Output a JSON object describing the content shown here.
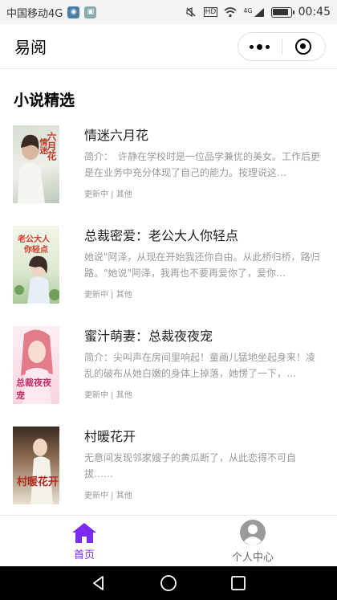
{
  "status_bar": {
    "carrier": "中国移动4G",
    "time": "00:45",
    "network": "4G",
    "hd": "HD",
    "battery_level": 0.9
  },
  "navbar": {
    "title": "易阅"
  },
  "section": {
    "title": "小说精选"
  },
  "books": [
    {
      "title": "情迷六月花",
      "desc": "简介：　许静在学校时是一位品学兼优的美女。工作后更是在业务中充分体现了自己的能力。按理说这…",
      "meta": "更新中 | 其他",
      "cover_text": "六月花 情迷",
      "cover_colors": [
        "#cfd8d0",
        "#f2f2ec"
      ]
    },
    {
      "title": "总裁密爱：老公大人你轻点",
      "desc": "她说\"阿泽，从现在开始我还你自由。从此桥归桥，路归路。\"她说\"阿泽，我再也不要再爱你了，爱你…",
      "meta": "更新中 | 其他",
      "cover_text": "老公大人 你轻点",
      "cover_colors": [
        "#e8f0dc",
        "#c9dcc0"
      ]
    },
    {
      "title": "蜜汁萌妻：总裁夜夜宠",
      "desc": "简介：尖叫声在房间里响起！童画儿猛地坐起身来！凌乱的破布从她白嫩的身体上掉落，她愣了一下，…",
      "meta": "更新中 | 其他",
      "cover_text": "总裁夜夜宠",
      "cover_colors": [
        "#f7d9e3",
        "#fbeef2"
      ]
    },
    {
      "title": "村暖花开",
      "desc": "无意间发现邻家嫂子的黄瓜断了，从此恋得不可自拔……",
      "meta": "更新中 | 其他",
      "cover_text": "村暖花开",
      "cover_colors": [
        "#e9e3d6",
        "#c7b59a"
      ]
    }
  ],
  "tabbar": {
    "home_label": "首页",
    "profile_label": "个人中心",
    "active_color": "#7b2cf0",
    "inactive_color": "#999999"
  }
}
